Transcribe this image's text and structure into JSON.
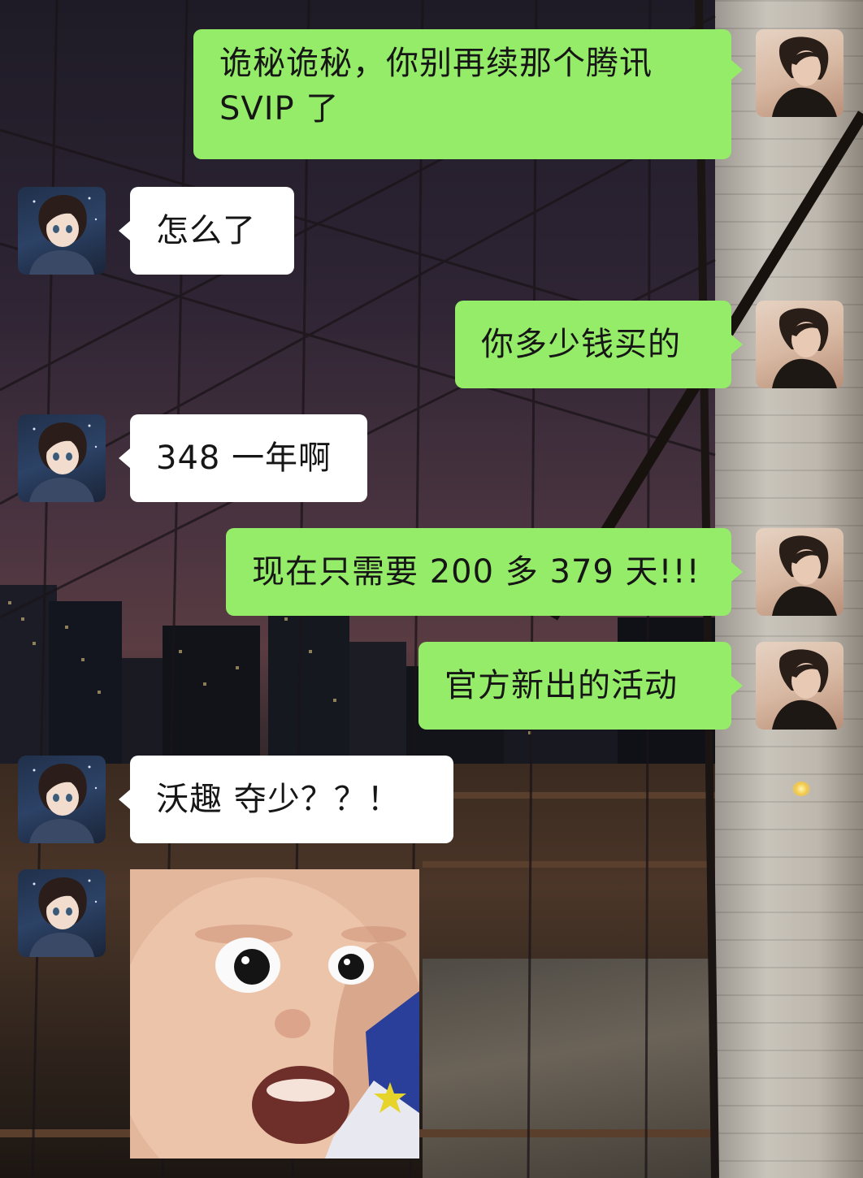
{
  "messages": [
    {
      "from": "me",
      "text_lines": [
        "诡秘诡秘，你别再续那个腾讯",
        "SVIP 了"
      ]
    },
    {
      "from": "friend",
      "text": "怎么了"
    },
    {
      "from": "me",
      "text": "你多少钱买的"
    },
    {
      "from": "friend",
      "text": "348 一年啊"
    },
    {
      "from": "me",
      "text": "现在只需要 200 多 379 天!!!"
    },
    {
      "from": "me",
      "text": "官方新出的活动"
    },
    {
      "from": "friend",
      "text": "沃趣 夺少？？！"
    },
    {
      "from": "friend",
      "type": "sticker",
      "icon": "surprised-baby-sticker"
    }
  ],
  "colors": {
    "my_bubble": "#95ec69",
    "friend_bubble": "#ffffff",
    "text": "#161616"
  },
  "avatars": {
    "me": "woman-portrait-avatar",
    "friend": "anime-girl-avatar"
  }
}
